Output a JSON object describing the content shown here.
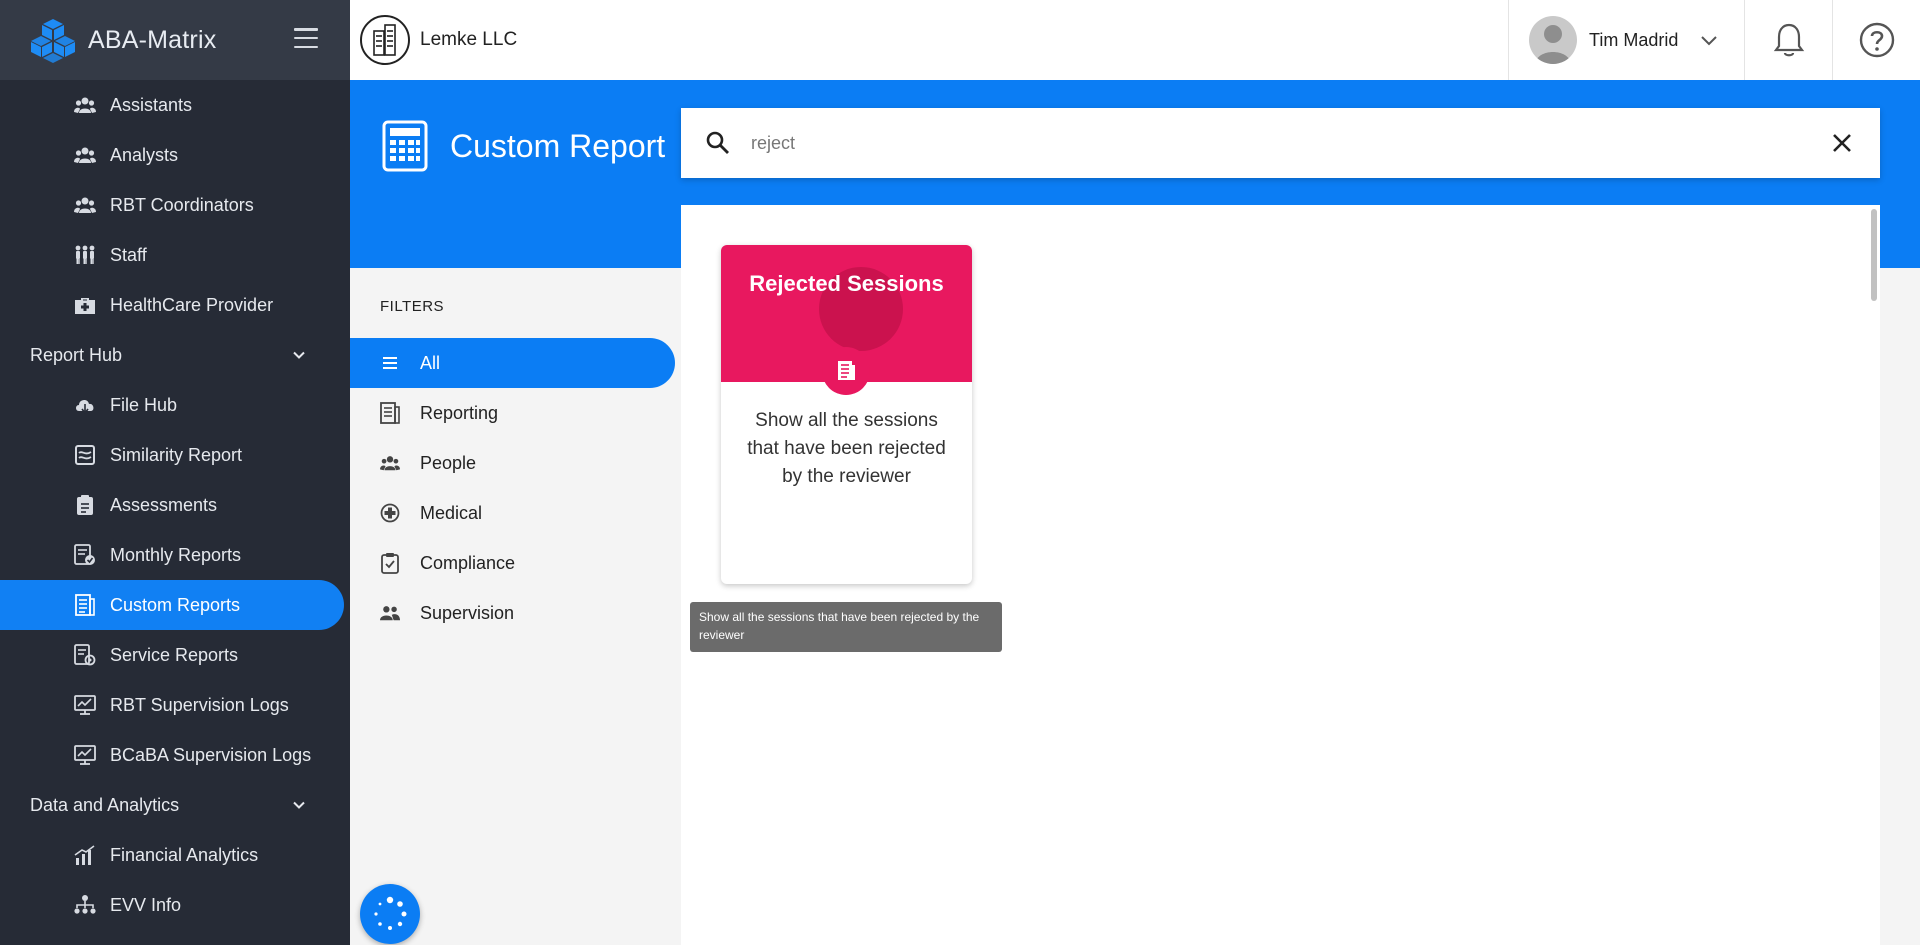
{
  "app": {
    "name": "ABA-Matrix"
  },
  "company": {
    "name": "Lemke LLC"
  },
  "user": {
    "name": "Tim Madrid"
  },
  "sidebar": {
    "items_top": [
      {
        "label": "Assistants",
        "icon": "users-icon"
      },
      {
        "label": "Analysts",
        "icon": "users-icon"
      },
      {
        "label": "RBT Coordinators",
        "icon": "users-icon"
      },
      {
        "label": "Staff",
        "icon": "staff-icon"
      },
      {
        "label": "HealthCare Provider",
        "icon": "medical-kit-icon"
      }
    ],
    "section_report_hub": "Report Hub",
    "items_report_hub": [
      {
        "label": "File Hub",
        "icon": "cloud-icon"
      },
      {
        "label": "Similarity Report",
        "icon": "similarity-icon"
      },
      {
        "label": "Assessments",
        "icon": "clipboard-icon"
      },
      {
        "label": "Monthly Reports",
        "icon": "monthly-report-icon"
      },
      {
        "label": "Custom Reports",
        "icon": "document-icon",
        "active": true
      },
      {
        "label": "Service Reports",
        "icon": "service-report-icon"
      },
      {
        "label": "RBT Supervision Logs",
        "icon": "chart-screen-icon"
      },
      {
        "label": "BCaBA Supervision Logs",
        "icon": "chart-screen-icon"
      }
    ],
    "section_data_analytics": "Data and Analytics",
    "items_data_analytics": [
      {
        "label": "Financial Analytics",
        "icon": "bar-chart-icon"
      },
      {
        "label": "EVV Info",
        "icon": "hierarchy-icon"
      }
    ]
  },
  "page": {
    "title": "Custom Report"
  },
  "search": {
    "value": "reject"
  },
  "filters": {
    "heading": "FILTERS",
    "items": [
      {
        "label": "All",
        "icon": "list-icon",
        "active": true
      },
      {
        "label": "Reporting",
        "icon": "report-icon"
      },
      {
        "label": "People",
        "icon": "people-icon"
      },
      {
        "label": "Medical",
        "icon": "plus-circle-icon"
      },
      {
        "label": "Compliance",
        "icon": "checklist-icon"
      },
      {
        "label": "Supervision",
        "icon": "supervision-icon"
      }
    ]
  },
  "cards": [
    {
      "title": "Rejected Sessions",
      "description": "Show all the sessions that have been rejected by the reviewer",
      "color": "#e8185f",
      "icon": "document-icon"
    }
  ],
  "tooltip": {
    "text": "Show all the sessions that have been rejected by the reviewer"
  },
  "colors": {
    "accent": "#0b7df4",
    "sidebar": "#262b36",
    "card": "#e8185f"
  }
}
